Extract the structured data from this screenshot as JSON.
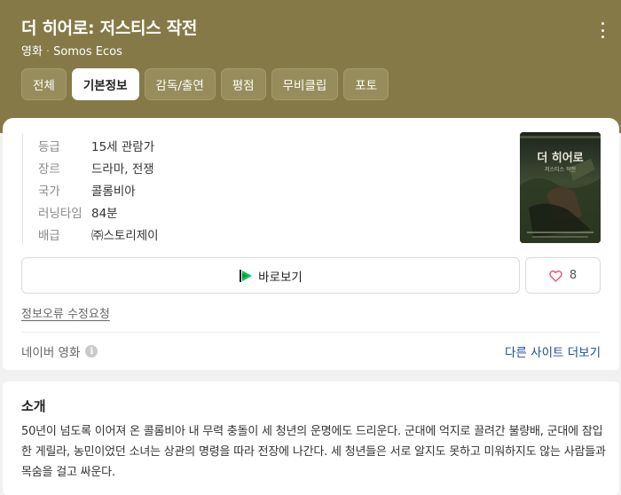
{
  "header": {
    "title": "더 히어로: 저스티스 작전",
    "category": "영화",
    "separator": "·",
    "company": "Somos Ecos",
    "more_icon": "more-vertical-icon"
  },
  "tabs": [
    {
      "label": "전체",
      "active": false
    },
    {
      "label": "기본정보",
      "active": true
    },
    {
      "label": "감독/출연",
      "active": false
    },
    {
      "label": "평점",
      "active": false
    },
    {
      "label": "무비클립",
      "active": false
    },
    {
      "label": "포토",
      "active": false
    }
  ],
  "info": [
    {
      "label": "등급",
      "value": "15세 관람가"
    },
    {
      "label": "장르",
      "value": "드라마, 전쟁"
    },
    {
      "label": "국가",
      "value": "콜롬비아"
    },
    {
      "label": "러닝타임",
      "value": "84분"
    },
    {
      "label": "배급",
      "value": "㈜스토리제이"
    }
  ],
  "poster": {
    "title_text": "더 히어로",
    "sub_text": "저스티스 작전"
  },
  "actions": {
    "watch_label": "바로보기",
    "like_count": "8",
    "watch_icon": "play-flag-icon",
    "like_icon": "heart-icon"
  },
  "report_link": "정보오류 수정요청",
  "source": {
    "label": "네이버 영화",
    "info_glyph": "i",
    "other_sites": "다른 사이트 더보기"
  },
  "intro": {
    "title": "소개",
    "body": "50년이 넘도록 이어져 온 콜롬비아 내 무력 충돌이 세 청년의 운명에도 드리운다. 군대에 억지로 끌려간 불량배, 군대에 잠입한 게릴라, 농민이었던 소녀는 상관의 명령을 따라 전장에 나간다. 세 청년들은 서로 알지도 못하고 미워하지도 않는 사람들과 목숨을 걸고 싸운다."
  },
  "colors": {
    "header_bg": "#857a47",
    "link": "#1d4c96",
    "heart": "#e0506e",
    "play_green": "#03c75a"
  }
}
